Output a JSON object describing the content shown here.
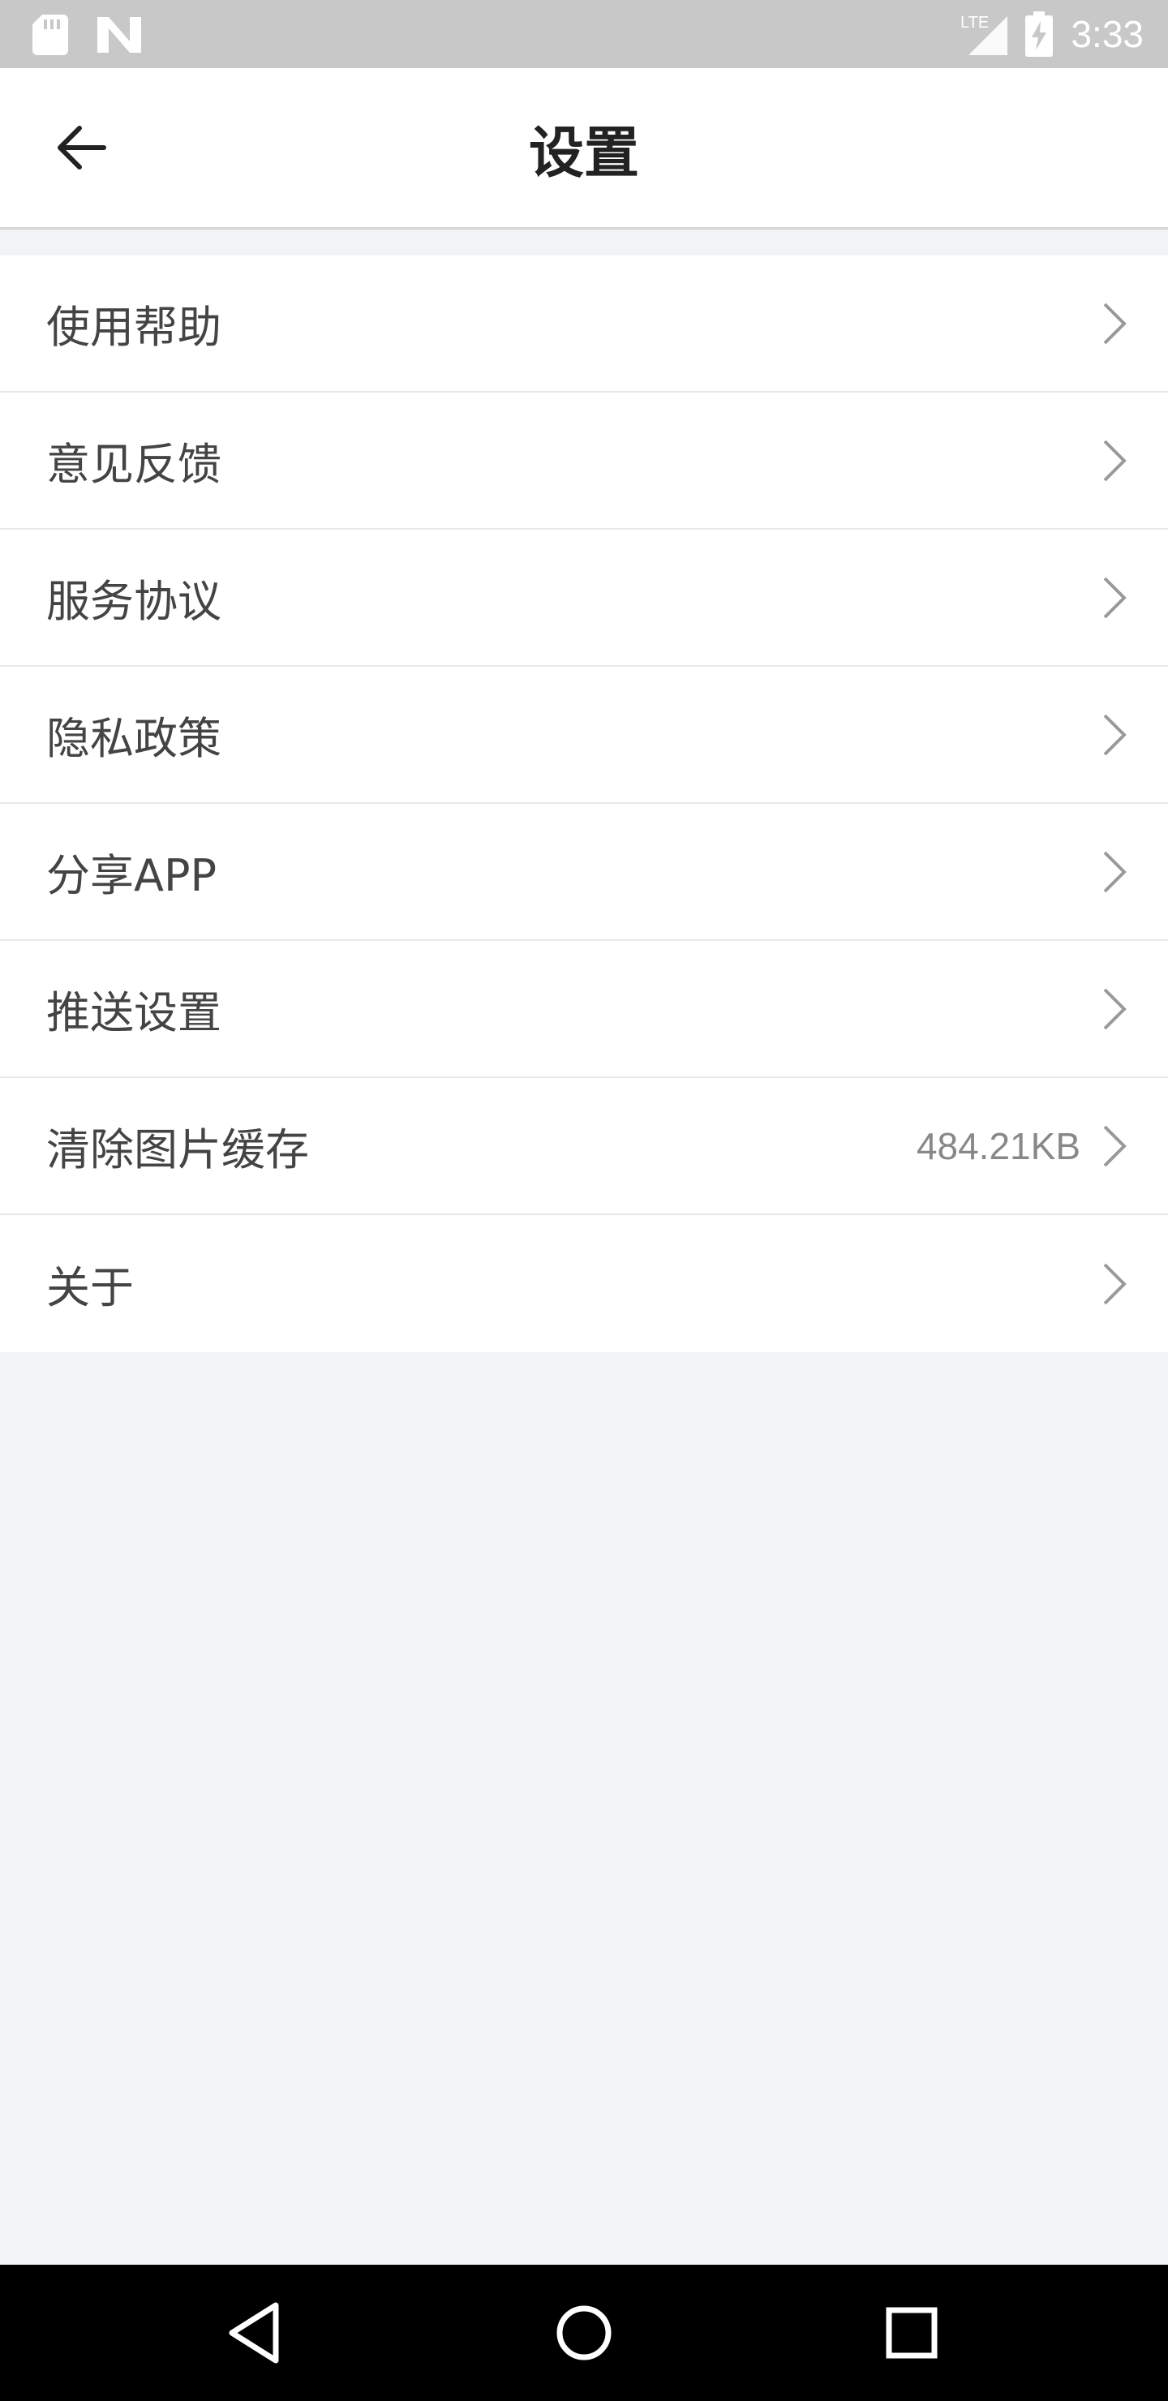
{
  "status_bar": {
    "time": "3:33",
    "network": "LTE",
    "icons": [
      "sd-card-icon",
      "n-logo-icon",
      "signal-icon",
      "battery-charging-icon"
    ]
  },
  "header": {
    "title": "设置",
    "back_icon": "arrow-left-icon"
  },
  "settings": {
    "items": [
      {
        "label": "使用帮助",
        "value": ""
      },
      {
        "label": "意见反馈",
        "value": ""
      },
      {
        "label": "服务协议",
        "value": ""
      },
      {
        "label": "隐私政策",
        "value": ""
      },
      {
        "label": "分享APP",
        "value": ""
      },
      {
        "label": "推送设置",
        "value": ""
      },
      {
        "label": "清除图片缓存",
        "value": "484.21KB"
      },
      {
        "label": "关于",
        "value": ""
      }
    ]
  },
  "nav_bar": {
    "icons": [
      "back-triangle-icon",
      "home-circle-icon",
      "recents-square-icon"
    ]
  },
  "colors": {
    "status_bar_bg": "#c8c8c8",
    "page_bg": "#f2f3f5",
    "row_bg": "#ffffff",
    "nav_bar_bg": "#000000"
  }
}
